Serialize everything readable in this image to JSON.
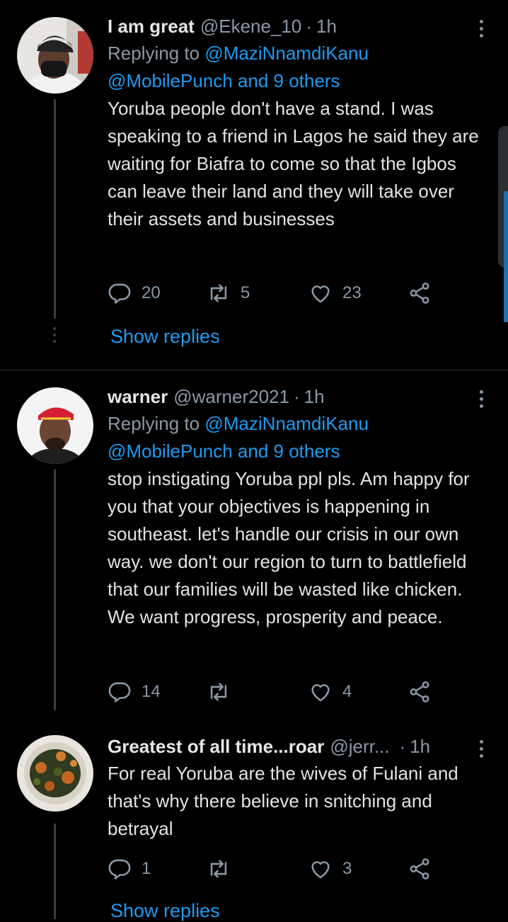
{
  "tweets": [
    {
      "name": "I am great",
      "handle": "@Ekene_10",
      "time": "1h",
      "replying_prefix": "Replying to ",
      "replying_mention": "@MaziNnamdiKanu",
      "replying_others": "@MobilePunch and 9 others",
      "text": "Yoruba people don't have a stand. I was speaking to a friend in Lagos he said they are waiting for Biafra to come so that the Igbos can leave their land and they will take over their assets and businesses",
      "replies": "20",
      "retweets": "5",
      "likes": "23",
      "show_replies": "Show replies"
    },
    {
      "name": "warner",
      "handle": "@warner2021",
      "time": "1h",
      "replying_prefix": "Replying to ",
      "replying_mention": "@MaziNnamdiKanu",
      "replying_others": "@MobilePunch and 9 others",
      "text": "stop instigating Yoruba ppl pls. Am happy for you that your objectives is happening in southeast. let's handle our crisis in our own way. we don't our region to turn to battlefield that our families will be wasted like chicken. We want progress, prosperity and peace.",
      "replies": "14",
      "retweets": "",
      "likes": "4"
    },
    {
      "name": "Greatest of all time...roar",
      "handle": "@jerr...",
      "time": "1h",
      "text": "For real Yoruba are the wives of Fulani and that's why there believe in snitching and betrayal",
      "replies": "1",
      "retweets": "",
      "likes": "3",
      "show_replies": "Show replies"
    }
  ],
  "separator": "·",
  "colors": {
    "background": "#000000",
    "link": "#1d9bf0",
    "muted": "#8b98a5",
    "divider": "#2f3336"
  },
  "icons": [
    "reply-icon",
    "retweet-icon",
    "like-icon",
    "share-icon",
    "more-icon"
  ]
}
